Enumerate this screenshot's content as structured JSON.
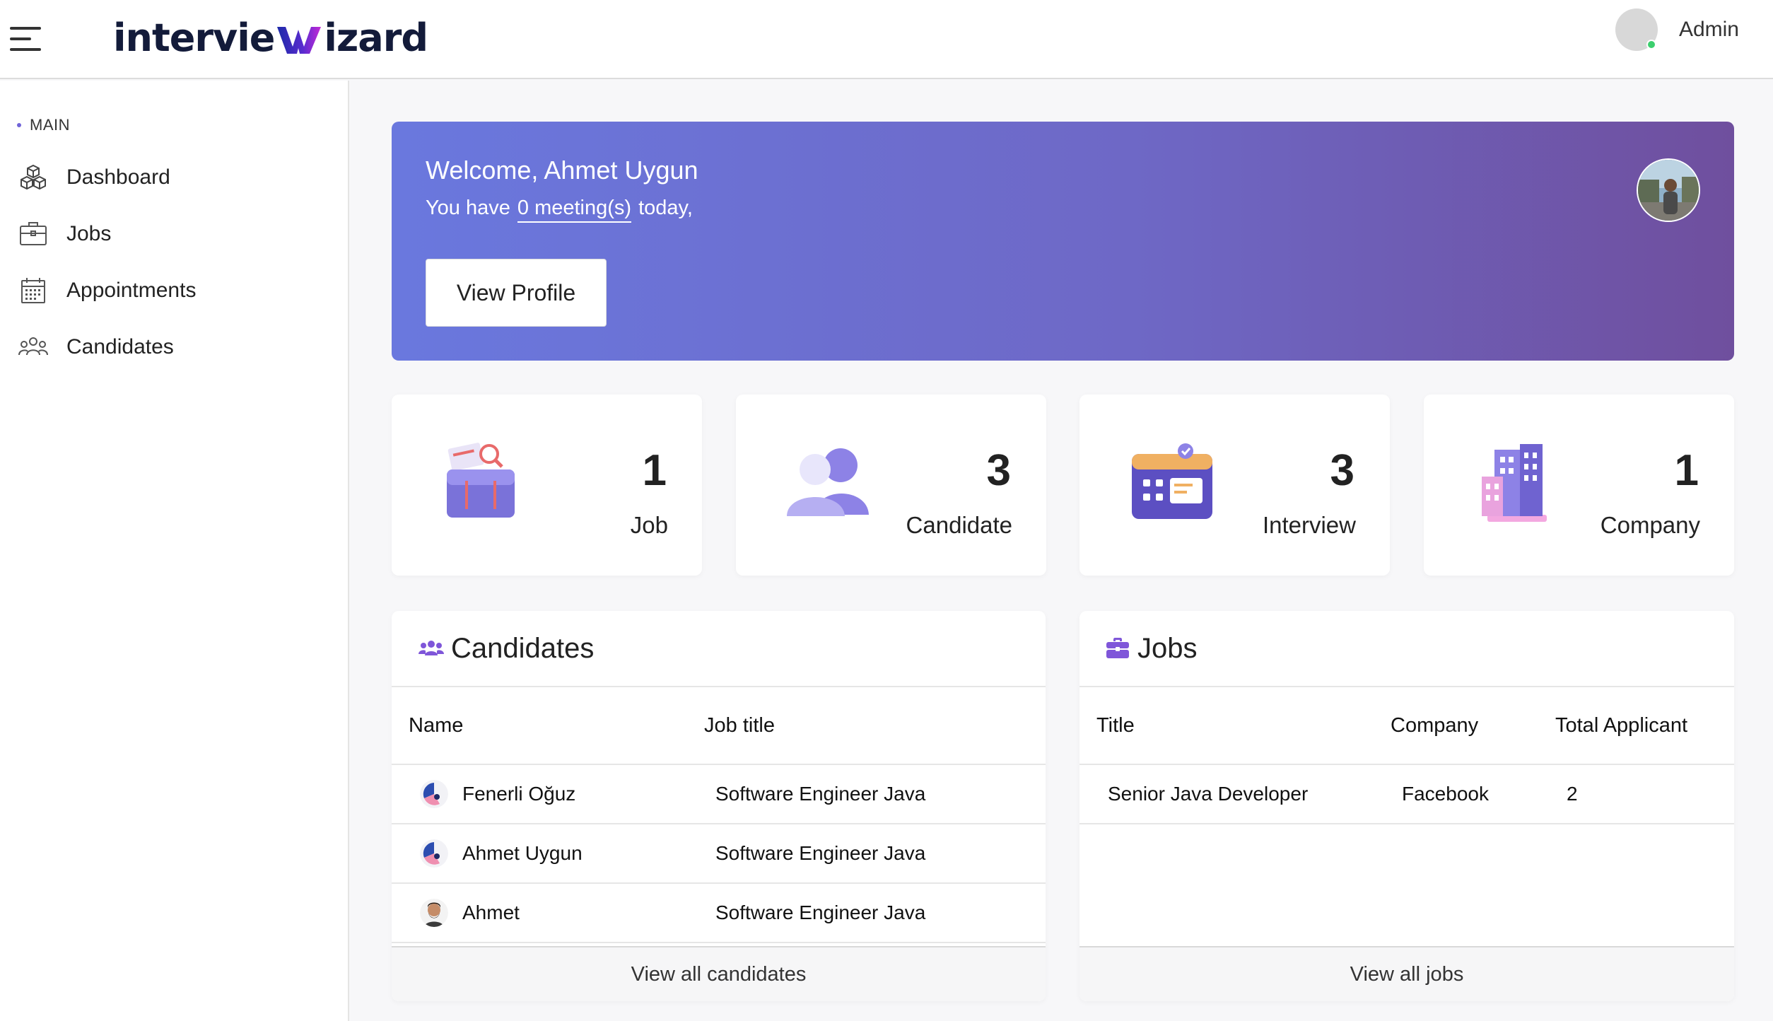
{
  "header": {
    "logo_left": "intervie",
    "logo_right": "izard",
    "admin_name": "Admin"
  },
  "sidebar": {
    "menu_title": "MAIN",
    "items": [
      {
        "label": "Dashboard",
        "icon": "cube-icon"
      },
      {
        "label": "Jobs",
        "icon": "briefcase-icon"
      },
      {
        "label": "Appointments",
        "icon": "calendar-icon"
      },
      {
        "label": "Candidates",
        "icon": "users-icon"
      }
    ]
  },
  "welcome": {
    "title": "Welcome, Ahmet Uygun",
    "sub_prefix": "You have",
    "meetings": "0 meeting(s)",
    "sub_suffix": "today,",
    "button": "View Profile"
  },
  "stats": [
    {
      "value": "1",
      "label": "Job",
      "icon": "briefcase-illustration"
    },
    {
      "value": "3",
      "label": "Candidate",
      "icon": "users-illustration"
    },
    {
      "value": "3",
      "label": "Interview",
      "icon": "calendar-illustration"
    },
    {
      "value": "1",
      "label": "Company",
      "icon": "building-illustration"
    }
  ],
  "candidates": {
    "title": "Candidates",
    "columns": [
      "Name",
      "Job title"
    ],
    "rows": [
      {
        "name": "Fenerli Oğuz",
        "job": "Software Engineer Java"
      },
      {
        "name": "Ahmet Uygun",
        "job": "Software Engineer Java"
      },
      {
        "name": "Ahmet",
        "job": "Software Engineer Java"
      }
    ],
    "footer": "View all candidates"
  },
  "jobs": {
    "title": "Jobs",
    "columns": [
      "Title",
      "Company",
      "Total Applicant"
    ],
    "rows": [
      {
        "title": "Senior Java Developer",
        "company": "Facebook",
        "applicants": "2"
      }
    ],
    "footer": "View all jobs"
  },
  "colors": {
    "accent": "#7064d8",
    "gradient_start": "#6a78de",
    "gradient_end": "#6f4f9e",
    "online": "#3ccf6e"
  }
}
